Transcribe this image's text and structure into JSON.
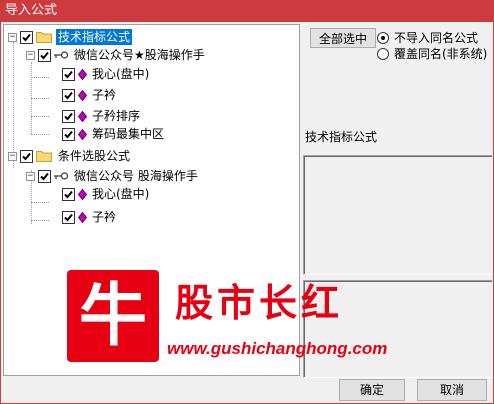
{
  "window": {
    "title": "导入公式"
  },
  "tree": {
    "nodes": [
      {
        "label": "技术指标公式",
        "level": 0,
        "type": "folder",
        "checked": true,
        "expanded": true,
        "selected": true
      },
      {
        "label": "微信公众号★股海操作手",
        "level": 1,
        "type": "author",
        "checked": true,
        "expanded": true
      },
      {
        "label": "我心(盘中)",
        "level": 2,
        "type": "formula",
        "checked": true
      },
      {
        "label": "子衿",
        "level": 2,
        "type": "formula",
        "checked": true
      },
      {
        "label": "子矜排序",
        "level": 2,
        "type": "formula",
        "checked": true
      },
      {
        "label": "筹码最集中区",
        "level": 2,
        "type": "formula",
        "checked": true
      },
      {
        "label": "条件选股公式",
        "level": 0,
        "type": "folder",
        "checked": true,
        "expanded": true
      },
      {
        "label": "微信公众号 股海操作手",
        "level": 1,
        "type": "author",
        "checked": true,
        "expanded": true
      },
      {
        "label": "我心(盘中)",
        "level": 2,
        "type": "formula",
        "checked": true
      },
      {
        "label": "子衿",
        "level": 2,
        "type": "formula",
        "checked": true
      }
    ]
  },
  "options": {
    "select_all_label": "全部选中",
    "radio_no_import": "不导入同名公式",
    "radio_overwrite": "覆盖同名(非系统)",
    "selected_radio": "no_import"
  },
  "detail": {
    "section_title": "技术指标公式"
  },
  "watermark": {
    "logo_char": "牛",
    "title": "股市长红",
    "url": "www.gushichanghong.com"
  },
  "buttons": {
    "ok": "确定",
    "cancel": "取消"
  },
  "colors": {
    "titlebar": "#cd3b3e",
    "selection": "#0078d7",
    "formula_icon": "#c000c0",
    "watermark": "#e60012"
  }
}
